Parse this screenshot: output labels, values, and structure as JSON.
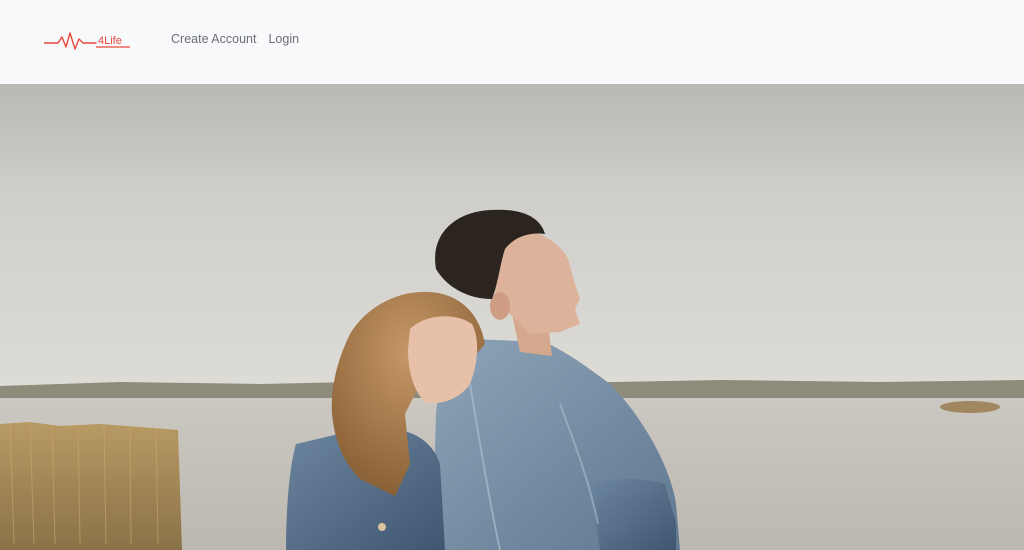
{
  "brand": {
    "logo_text": "4Life",
    "logo_icon": "heartbeat-line-icon",
    "accent_color": "#e8493c"
  },
  "nav": {
    "links": [
      {
        "label": "Create Account"
      },
      {
        "label": "Login"
      }
    ]
  },
  "hero": {
    "image_subject": "couple-by-the-lake-photo"
  }
}
